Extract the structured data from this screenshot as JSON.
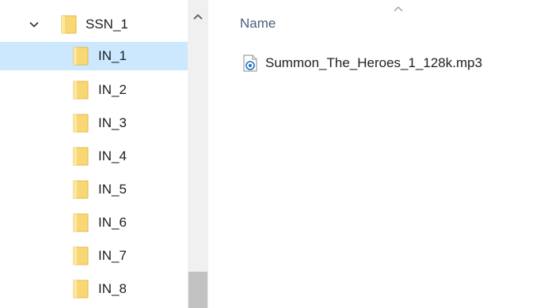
{
  "nav_tree": {
    "parent": {
      "label": "SSN_1",
      "expanded": true,
      "icon": "folder-icon"
    },
    "children": [
      {
        "label": "IN_1",
        "selected": true
      },
      {
        "label": "IN_2",
        "selected": false
      },
      {
        "label": "IN_3",
        "selected": false
      },
      {
        "label": "IN_4",
        "selected": false
      },
      {
        "label": "IN_5",
        "selected": false
      },
      {
        "label": "IN_6",
        "selected": false
      },
      {
        "label": "IN_7",
        "selected": false
      },
      {
        "label": "IN_8",
        "selected": false
      }
    ]
  },
  "file_list": {
    "column_header": "Name",
    "sort_direction": "ascending",
    "files": [
      {
        "name": "Summon_The_Heroes_1_128k.mp3",
        "icon": "audio-file-icon"
      }
    ]
  },
  "colors": {
    "selection": "#cce8ff",
    "folder": "#f8d775",
    "header_text": "#4c607a",
    "scrollbar_track": "#f0f0f0",
    "scrollbar_thumb": "#c2c2c2"
  }
}
